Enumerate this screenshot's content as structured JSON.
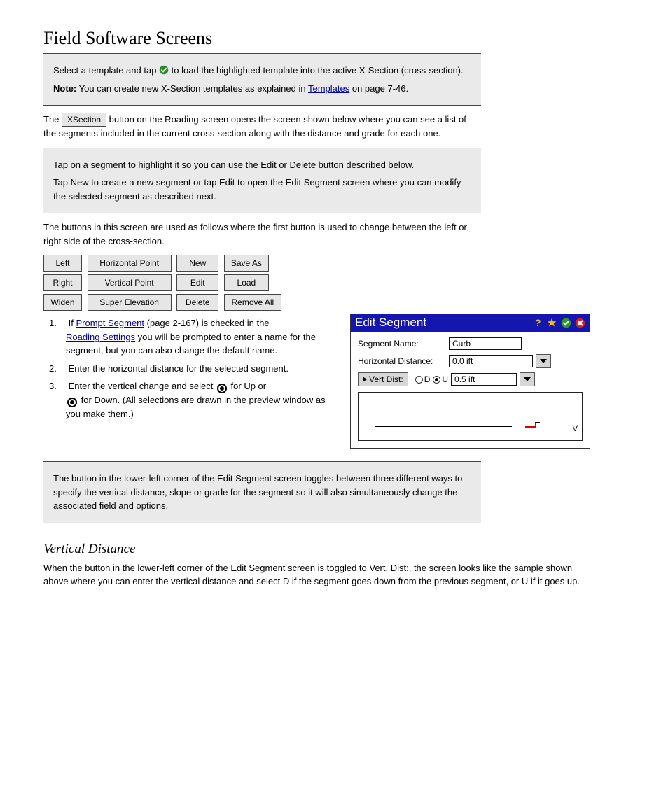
{
  "page": {
    "title": "Field Software Screens"
  },
  "callout1": {
    "line1_a": "Select a template and tap ",
    "line1_b": " to load the highlighted template into the active X-Section (cross-section).",
    "note_label": "Note:",
    "note_text_a": " You can create new X-Section templates as explained in ",
    "note_link": "Templates",
    "note_text_b": " on page 7-46."
  },
  "para1_a": "The ",
  "para1_btn": "XSection",
  "para1_b": " button on the Roading screen opens the screen shown below where you can see a list of the segments included in the current cross-section along with the distance and grade for each one.",
  "callout2": {
    "line1": "Tap on a segment to highlight it so you can use the Edit or Delete button described below.",
    "line2": "Tap New to create a new segment or tap Edit to open the Edit Segment screen where you can modify the selected segment as described next."
  },
  "para2_a": "The buttons in this screen are used as follows where the first button is used to change between the left or right side of the cross-section.",
  "grid": {
    "r1": [
      "Left",
      "Horizontal Point",
      "New",
      "Save As"
    ],
    "r2": [
      "Right",
      "Vertical Point",
      "Edit",
      "Load"
    ],
    "r3": [
      "Widen",
      "Super Elevation",
      "Delete",
      "Remove All"
    ]
  },
  "dialog": {
    "title": "Edit Segment",
    "seg_label": "Segment Name:",
    "seg_value": "Curb",
    "hdist_label": "Horizontal Distance:",
    "hdist_value": "0.0 ift",
    "vd_btn": "Vert Dist:",
    "vd_d": "D",
    "vd_u": "U",
    "vd_value": "0.5 ift",
    "preview_v": "V"
  },
  "steps": {
    "s1_a": "1.",
    "s1_b": "If ",
    "s1_link": "Prompt Segment",
    "s1_c": " (page 2-167) is checked in the ",
    "s1_link2": "Roading Settings",
    "s1_d": " you will be prompted to enter a name for the segment, but you can also change the default name.",
    "s2_a": "2.",
    "s2_b": "Enter the horizontal distance for the selected segment.",
    "s3_a": "3.",
    "s3_b": "Enter the vertical change and select ",
    "s3_c": " for Up or ",
    "s3_d": " for Down. (All selections are drawn in the preview window as you make them.)"
  },
  "callout3": {
    "line1": "The button in the lower-left corner of the Edit Segment screen toggles between three different ways to specify the vertical distance, slope or grade for the segment so it will also simultaneously change the associated field and options."
  },
  "subheading": "Vertical Distance",
  "para3": "When the button in the lower-left corner of the Edit Segment screen is toggled to Vert. Dist:, the screen looks like the sample shown above where you can enter the vertical distance and select D if the segment goes down from the previous segment, or U if it goes up."
}
